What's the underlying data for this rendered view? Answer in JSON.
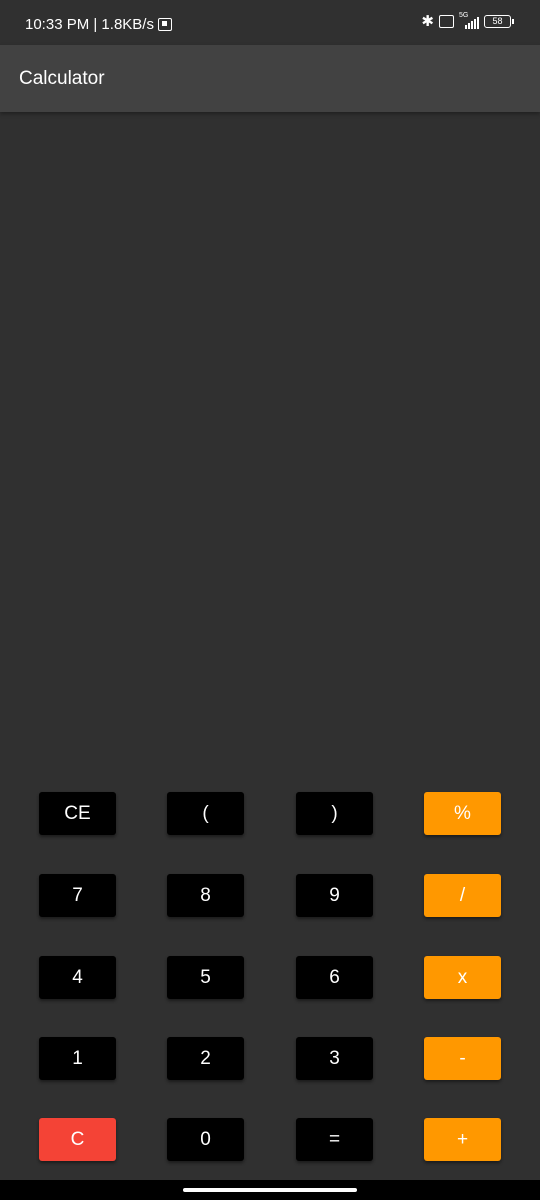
{
  "status_bar": {
    "time_speed": "10:33 PM | 1.8KB/s",
    "network": "5G",
    "battery": "58",
    "icons": [
      "notification-icon",
      "bluetooth-icon",
      "volte-icon",
      "signal-icon",
      "battery-icon"
    ]
  },
  "app_bar": {
    "title": "Calculator"
  },
  "display": {
    "expression": "",
    "result": ""
  },
  "keypad": {
    "rows": [
      [
        "CE",
        "(",
        ")",
        "%"
      ],
      [
        "7",
        "8",
        "9",
        "/"
      ],
      [
        "4",
        "5",
        "6",
        "x"
      ],
      [
        "1",
        "2",
        "3",
        "-"
      ],
      [
        "C",
        "0",
        "=",
        "+"
      ]
    ]
  },
  "colors": {
    "background": "#303030",
    "app_bar": "#424242",
    "number_key": "#000000",
    "operator_key": "#ff9800",
    "clear_key": "#f44336",
    "text": "#ffffff"
  }
}
